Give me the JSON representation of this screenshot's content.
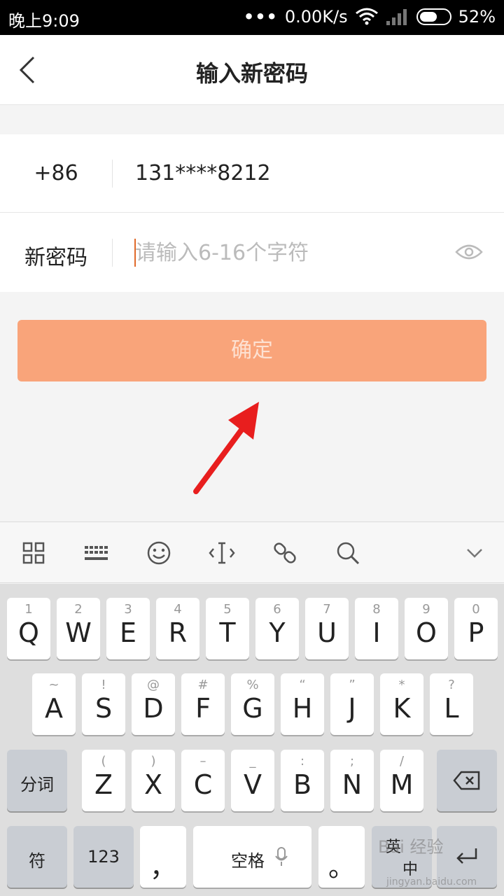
{
  "status_bar": {
    "time": "晚上9:09",
    "dots": "•••",
    "speed": "0.00K/s",
    "battery": "52%"
  },
  "nav": {
    "title": "输入新密码"
  },
  "form": {
    "country_code": "+86",
    "phone": "131****8212",
    "password_label": "新密码",
    "password_placeholder": "请输入6-16个字符",
    "password_value": ""
  },
  "confirm_button": {
    "label": "确定"
  },
  "keyboard": {
    "row1": [
      {
        "hint": "1",
        "key": "Q"
      },
      {
        "hint": "2",
        "key": "W"
      },
      {
        "hint": "3",
        "key": "E"
      },
      {
        "hint": "4",
        "key": "R"
      },
      {
        "hint": "5",
        "key": "T"
      },
      {
        "hint": "6",
        "key": "Y"
      },
      {
        "hint": "7",
        "key": "U"
      },
      {
        "hint": "8",
        "key": "I"
      },
      {
        "hint": "9",
        "key": "O"
      },
      {
        "hint": "0",
        "key": "P"
      }
    ],
    "row2": [
      {
        "hint": "~",
        "key": "A"
      },
      {
        "hint": "!",
        "key": "S"
      },
      {
        "hint": "@",
        "key": "D"
      },
      {
        "hint": "#",
        "key": "F"
      },
      {
        "hint": "%",
        "key": "G"
      },
      {
        "hint": "“",
        "key": "H"
      },
      {
        "hint": "”",
        "key": "J"
      },
      {
        "hint": "*",
        "key": "K"
      },
      {
        "hint": "?",
        "key": "L"
      }
    ],
    "row3": [
      {
        "hint": "(",
        "key": "Z"
      },
      {
        "hint": ")",
        "key": "X"
      },
      {
        "hint": "–",
        "key": "C"
      },
      {
        "hint": "_",
        "key": "V"
      },
      {
        "hint": ":",
        "key": "B"
      },
      {
        "hint": ";",
        "key": "N"
      },
      {
        "hint": "/",
        "key": "M"
      }
    ],
    "segment_label": "分词",
    "symbol_label": "符",
    "number_label": "123",
    "comma": "，",
    "space_label": "空格",
    "period": "。",
    "lang_label": "英",
    "lang_sub": "中"
  },
  "watermark": {
    "text": "Bai 经验",
    "url": "jingyan.baidu.com"
  },
  "colors": {
    "confirm_bg": "#f9a47a",
    "confirm_text": "#fde1d2",
    "caret": "#e06a2a",
    "arrow": "#e81e1e"
  }
}
